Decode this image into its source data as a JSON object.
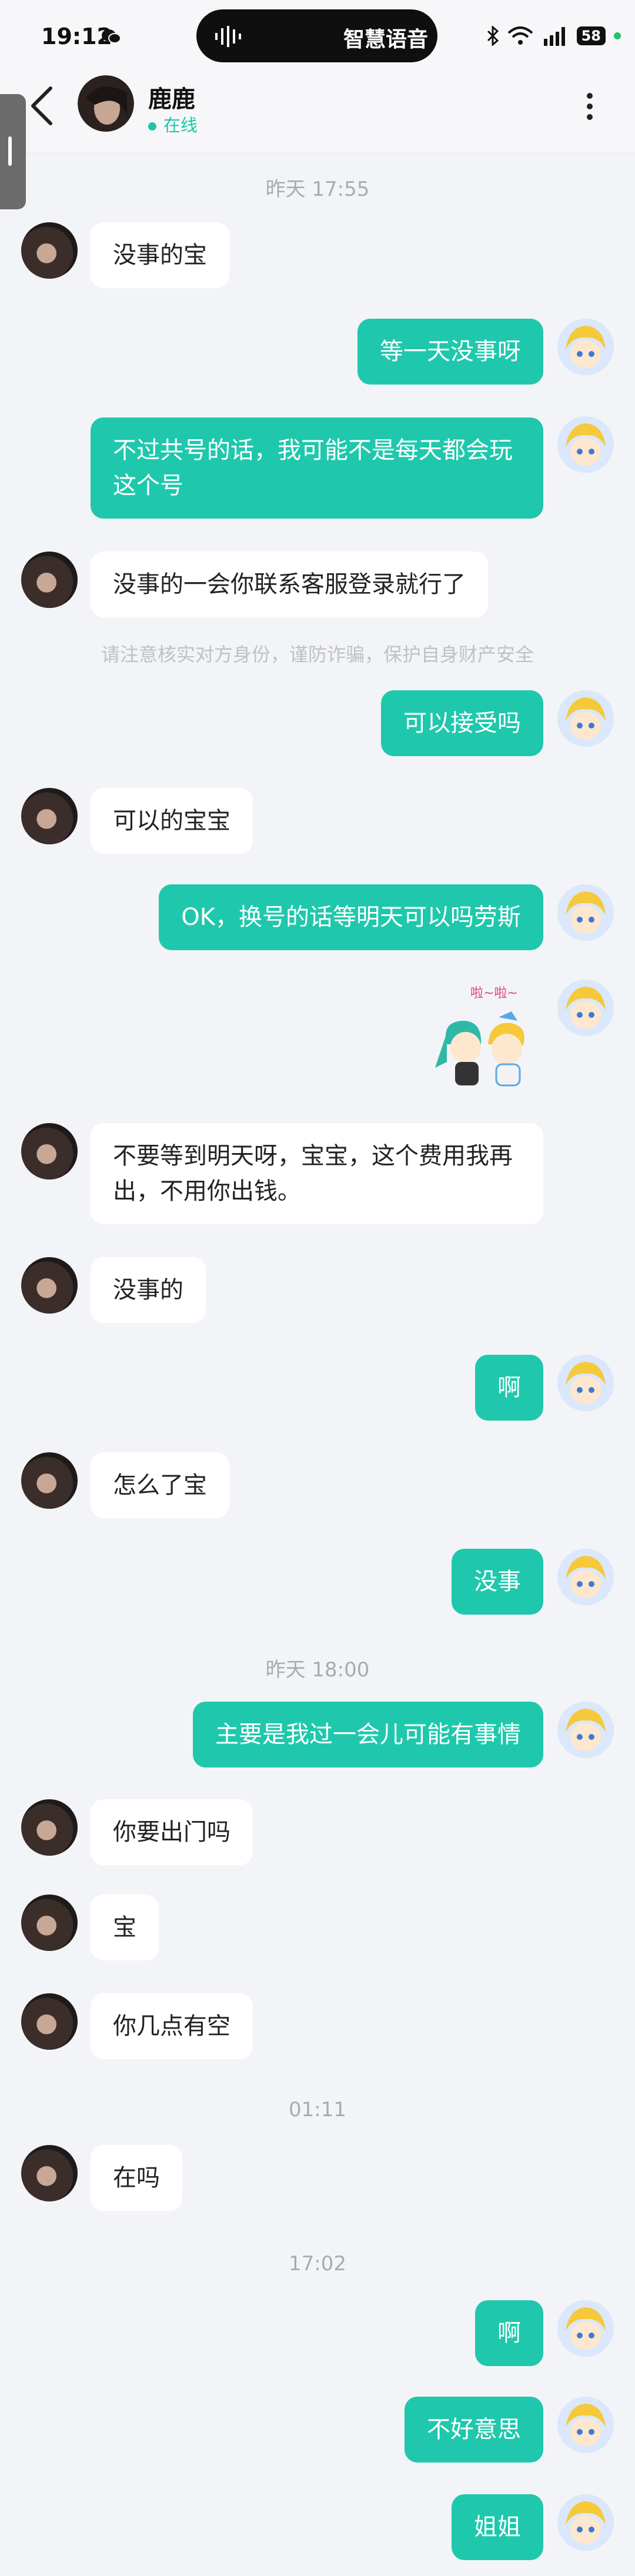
{
  "status_bar": {
    "time": "19:12",
    "voice_label": "智慧语音",
    "battery": "58"
  },
  "header": {
    "back_icon": "chevron-left-icon",
    "name": "鹿鹿",
    "status": "在线",
    "more_icon": "more-vertical-icon"
  },
  "colors": {
    "accent": "#1fc8ac",
    "background": "#f3f4f8",
    "incoming": "#ffffff"
  },
  "messages": [
    {
      "type": "time",
      "text": "昨天  17:55"
    },
    {
      "type": "in",
      "text": "没事的宝"
    },
    {
      "type": "out",
      "text": "等一天没事呀"
    },
    {
      "type": "out",
      "text": "不过共号的话，我可能不是每天都会玩这个号"
    },
    {
      "type": "in",
      "text": "没事的一会你联系客服登录就行了"
    },
    {
      "type": "tip",
      "text": "请注意核实对方身份，谨防诈骗，保护自身财产安全"
    },
    {
      "type": "out",
      "text": "可以接受吗"
    },
    {
      "type": "in",
      "text": "可以的宝宝"
    },
    {
      "type": "out",
      "text": "OK，换号的话等明天可以吗劳斯"
    },
    {
      "type": "out_sticker",
      "text": "啦~啦~"
    },
    {
      "type": "in",
      "text": "不要等到明天呀，宝宝，这个费用我再出，不用你出钱。"
    },
    {
      "type": "in",
      "text": "没事的"
    },
    {
      "type": "out",
      "text": "啊"
    },
    {
      "type": "in",
      "text": "怎么了宝"
    },
    {
      "type": "out",
      "text": "没事"
    },
    {
      "type": "time",
      "text": "昨天  18:00"
    },
    {
      "type": "out",
      "text": "主要是我过一会儿可能有事情"
    },
    {
      "type": "in",
      "text": "你要出门吗"
    },
    {
      "type": "in",
      "text": "宝"
    },
    {
      "type": "in",
      "text": "你几点有空"
    },
    {
      "type": "time",
      "text": "01:11"
    },
    {
      "type": "in",
      "text": "在吗"
    },
    {
      "type": "time",
      "text": "17:02"
    },
    {
      "type": "out",
      "text": "啊"
    },
    {
      "type": "out",
      "text": "不好意思"
    },
    {
      "type": "out",
      "text": "姐姐"
    }
  ]
}
